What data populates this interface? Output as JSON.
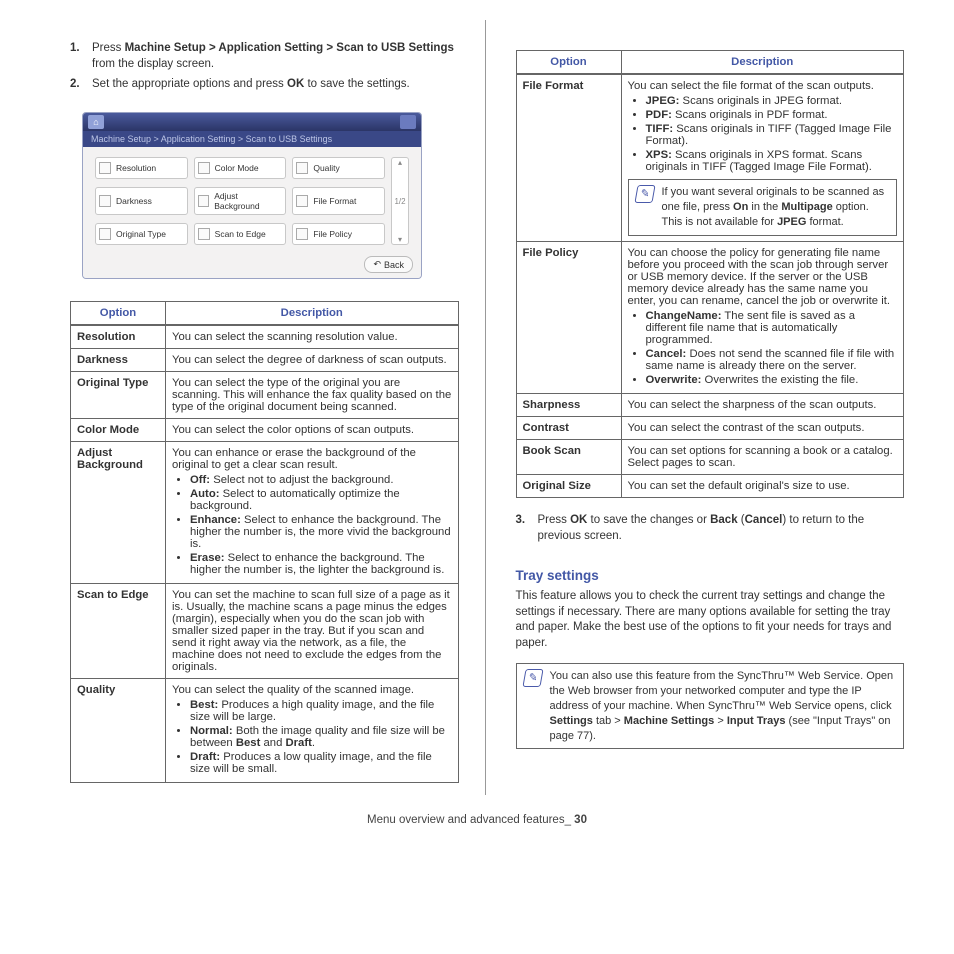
{
  "steps_a": [
    {
      "num": "1.",
      "pre": "Press ",
      "path": "Machine Setup > Application Setting > Scan to USB Settings",
      "post": " from the display screen."
    },
    {
      "num": "2.",
      "pre": "Set the appropriate options and press ",
      "bold": "OK",
      "post": " to save the settings."
    }
  ],
  "devshot": {
    "crumb": "Machine Setup > Application Setting > Scan to USB Settings",
    "buttons": [
      "Resolution",
      "Color Mode",
      "Quality",
      "Darkness",
      "Adjust Background",
      "File Format",
      "Original Type",
      "Scan to Edge",
      "File Policy"
    ],
    "page": "1/2",
    "back": "Back"
  },
  "th_option": "Option",
  "th_desc": "Description",
  "table_left": [
    {
      "k": "Resolution",
      "html": "You can select the scanning resolution value."
    },
    {
      "k": "Darkness",
      "html": "You can select the degree of darkness of scan outputs."
    },
    {
      "k": "Original Type",
      "html": "You can select the type of the original you are scanning. This will enhance the fax quality based on the type of the original document being scanned."
    },
    {
      "k": "Color Mode",
      "html": "You can select the color options of scan outputs."
    },
    {
      "k": "Adjust Background",
      "html": "You can enhance or erase the background of the original to get a clear scan result.",
      "bullets": [
        {
          "b": "Off:",
          "t": " Select not to adjust the background."
        },
        {
          "b": "Auto:",
          "t": " Select to automatically optimize the background."
        },
        {
          "b": "Enhance:",
          "t": " Select to enhance the background. The higher the number is, the more vivid the background is."
        },
        {
          "b": "Erase:",
          "t": " Select to enhance the background. The higher the number is, the lighter the background is."
        }
      ]
    },
    {
      "k": "Scan to Edge",
      "html": "You can set the machine to scan full size of a page as it is. Usually, the machine scans a page minus the edges (margin), especially when you do the scan job with smaller sized paper in the tray. But if you scan and send it right away via the network, as a file, the machine does not need to exclude the edges from the originals."
    },
    {
      "k": "Quality",
      "html": "You can select the quality of the scanned image.",
      "bullets": [
        {
          "b": "Best:",
          "t": " Produces a high quality image, and the file size will be large."
        },
        {
          "b": "Normal:",
          "t": " Both the image quality and file size will be between <b>Best</b> and <b>Draft</b>."
        },
        {
          "b": "Draft:",
          "t": " Produces a low quality image, and the file size will be small."
        }
      ]
    }
  ],
  "table_right": [
    {
      "k": "File Format",
      "html": "You can select the file format of the scan outputs.",
      "bullets": [
        {
          "b": "JPEG:",
          "t": " Scans originals in JPEG format."
        },
        {
          "b": "PDF:",
          "t": " Scans originals in PDF format."
        },
        {
          "b": "TIFF:",
          "t": " Scans originals in TIFF (Tagged Image File Format)."
        },
        {
          "b": "XPS:",
          "t": " Scans originals in XPS format. Scans originals in TIFF (Tagged Image File Format)."
        }
      ],
      "note": "If you want several originals to be scanned as one file, press <b>On</b> in the <b>Multipage</b> option. This is not available for <b>JPEG</b> format."
    },
    {
      "k": "File Policy",
      "html": "You can choose the policy for generating file name before you proceed with the scan job through server or USB memory device. If the server or the USB memory device already has the same name you enter, you can rename, cancel the job or overwrite it.",
      "bullets": [
        {
          "b": "ChangeName:",
          "t": " The sent file is saved as a different file name that is automatically programmed."
        },
        {
          "b": "Cancel:",
          "t": " Does not send the scanned file if file with same name is already there on the server."
        },
        {
          "b": "Overwrite:",
          "t": " Overwrites the existing the file."
        }
      ]
    },
    {
      "k": "Sharpness",
      "html": "You can select the sharpness of the scan outputs."
    },
    {
      "k": "Contrast",
      "html": "You can select the contrast of the scan outputs."
    },
    {
      "k": "Book Scan",
      "html": "You can set options for scanning a book or a catalog. Select pages to scan."
    },
    {
      "k": "Original Size",
      "html": "You can set the default original's size to use."
    }
  ],
  "step3": {
    "num": "3.",
    "text": "Press <b>OK</b> to save the changes or <b>Back</b> (<b>Cancel</b>) to return to the previous screen."
  },
  "tray_heading": "Tray settings",
  "tray_body": "This feature allows you to check the current tray settings and change the settings if necessary. There are many options available for setting the tray and paper. Make the best use of the options to fit your needs for trays and paper.",
  "tray_note": "You can also use this feature from the SyncThru™ Web Service. Open the Web browser from your networked computer and type the IP address of your machine. When SyncThru™ Web Service opens, click <b>Settings</b> tab > <b>Machine Settings</b> > <b>Input Trays</b> (see \"Input Trays\" on page 77).",
  "footer": {
    "label": "Menu overview and advanced features_",
    "page": "30"
  }
}
